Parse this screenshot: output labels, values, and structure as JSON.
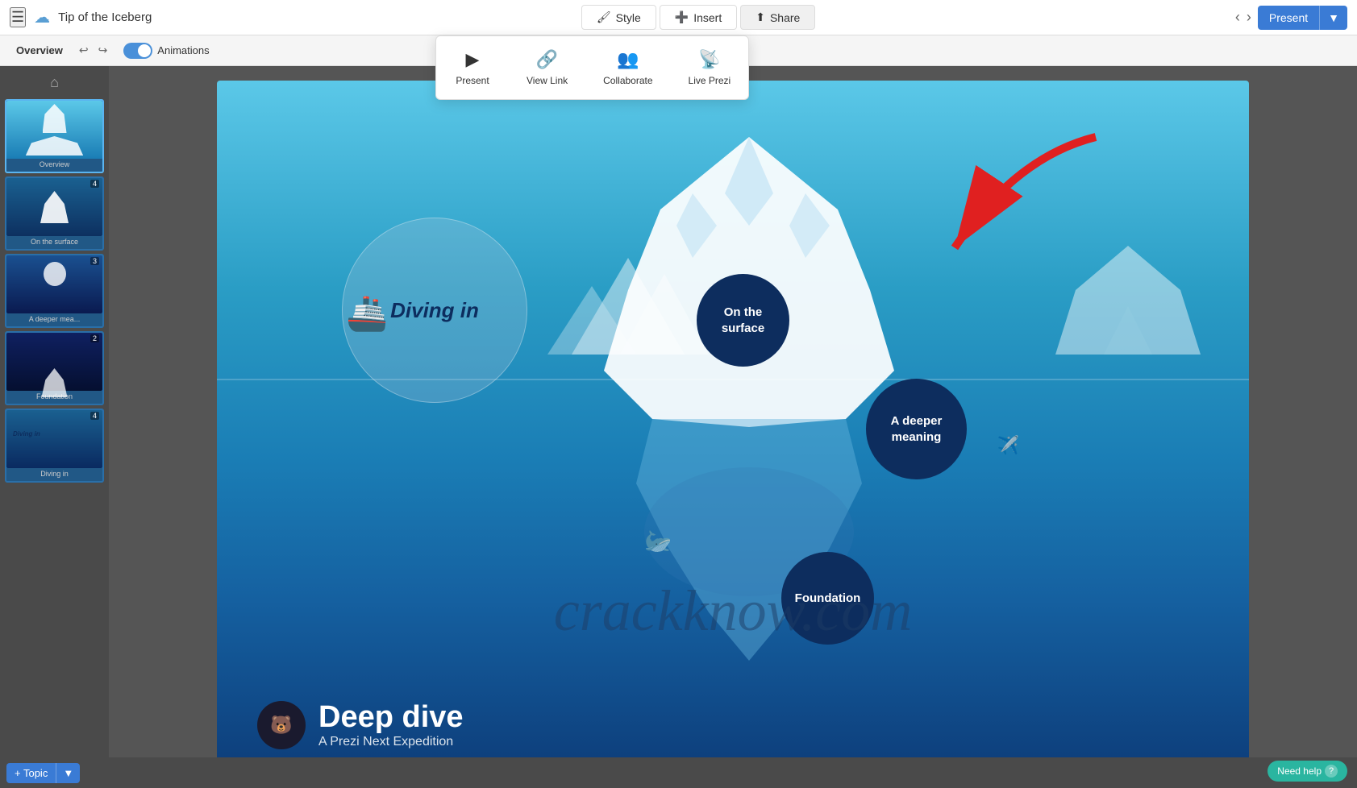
{
  "topbar": {
    "title": "Tip of the Iceberg",
    "style_label": "Style",
    "insert_label": "Insert",
    "share_label": "Share",
    "present_label": "Present",
    "hamburger": "☰",
    "cloud_icon": "☁"
  },
  "secondbar": {
    "overview_label": "Overview",
    "animations_label": "Animations"
  },
  "share_menu": {
    "present_label": "Present",
    "view_link_label": "View Link",
    "collaborate_label": "Collaborate",
    "live_prezi_label": "Live Prezi"
  },
  "slides": [
    {
      "num": "",
      "label": "Overview",
      "type": "overview"
    },
    {
      "num": "4",
      "label": "On the surface",
      "type": "surface"
    },
    {
      "num": "3",
      "label": "A deeper mea...",
      "type": "deeper"
    },
    {
      "num": "2",
      "label": "Foundation",
      "type": "foundation"
    },
    {
      "num": "4",
      "label": "Diving in",
      "type": "divein"
    }
  ],
  "canvas": {
    "bubble_surface": "On the surface",
    "bubble_deeper_line1": "A deeper",
    "bubble_deeper_line2": "meaning",
    "bubble_foundation": "Foundation",
    "diving_in": "Diving in",
    "deep_dive_title": "Deep dive",
    "deep_dive_subtitle": "A Prezi Next Expedition",
    "watermark": "crackknow.com"
  },
  "bottom": {
    "add_topic_label": "+ Topic"
  },
  "need_help": {
    "label": "Need help",
    "icon": "?"
  }
}
